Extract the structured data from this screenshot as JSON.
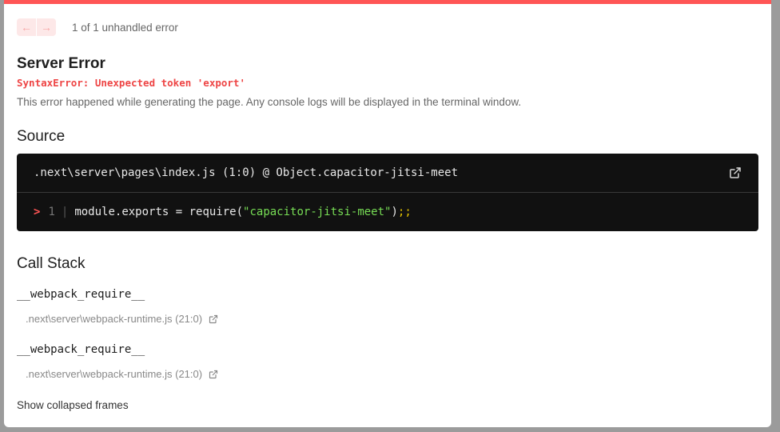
{
  "nav": {
    "prev_glyph": "←",
    "next_glyph": "→",
    "counter": "1 of 1 unhandled error"
  },
  "error": {
    "title": "Server Error",
    "message": "SyntaxError: Unexpected token 'export'",
    "description": "This error happened while generating the page. Any console logs will be displayed in the terminal window."
  },
  "source": {
    "heading": "Source",
    "file": ".next\\server\\pages\\index.js (1:0) @ Object.capacitor-jitsi-meet",
    "line_marker": ">",
    "line_number": "1",
    "gutter": "|",
    "code_prefix": "module.exports = require(",
    "code_string": "\"capacitor-jitsi-meet\"",
    "code_suffix": ")",
    "code_semicolons": ";;"
  },
  "call_stack": {
    "heading": "Call Stack",
    "frames": [
      {
        "fn": "__webpack_require__",
        "file": ".next\\server\\webpack-runtime.js (21:0)"
      },
      {
        "fn": "__webpack_require__",
        "file": ".next\\server\\webpack-runtime.js (21:0)"
      }
    ],
    "show_collapsed": "Show collapsed frames"
  },
  "icons": {
    "open_external": "external-link-icon"
  },
  "colors": {
    "accent_red": "#ff5555",
    "code_bg": "#111111",
    "string_green": "#77dd55"
  }
}
